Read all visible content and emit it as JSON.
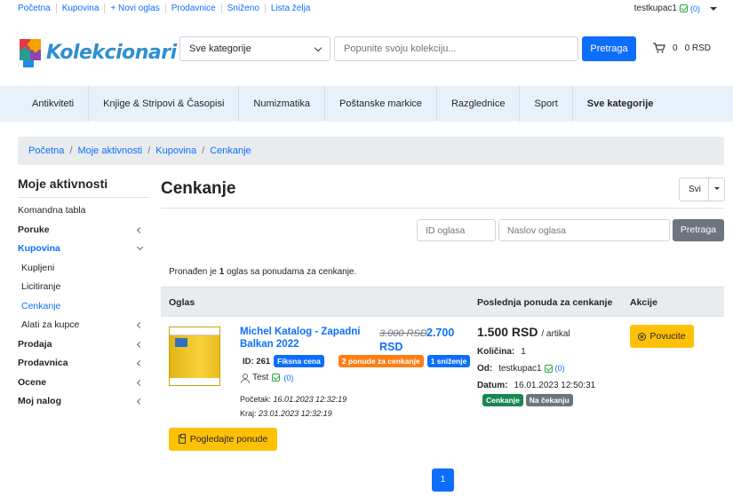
{
  "topbar": {
    "links": [
      "Početna",
      "Kupovina",
      "+ Novi oglas",
      "Prodavnice",
      "Sniženo",
      "Lista želja"
    ],
    "user": "testkupac1",
    "user_count": "(0)"
  },
  "header": {
    "logo_text": "Kolekcionari",
    "category_select": "Sve kategorije",
    "search_placeholder": "Popunite svoju kolekciju...",
    "search_button": "Pretraga",
    "cart_count": "0",
    "cart_total": "0 RSD"
  },
  "nav": [
    "Antikviteti",
    "Knjige & Stripovi & Časopisi",
    "Numizmatika",
    "Poštanske markice",
    "Razglednice",
    "Sport",
    "Sve kategorije"
  ],
  "breadcrumb": [
    "Početna",
    "Moje aktivnosti",
    "Kupovina",
    "Cenkanje"
  ],
  "sidebar": {
    "title": "Moje aktivnosti",
    "items": [
      {
        "label": "Komandna tabla"
      },
      {
        "label": "Poruke"
      },
      {
        "label": "Kupovina"
      },
      {
        "label": "Kupljeni"
      },
      {
        "label": "Licitiranje"
      },
      {
        "label": "Cenkanje"
      },
      {
        "label": "Alati za kupce"
      },
      {
        "label": "Prodaja"
      },
      {
        "label": "Prodavnica"
      },
      {
        "label": "Ocene"
      },
      {
        "label": "Moj nalog"
      }
    ]
  },
  "main": {
    "title": "Cenkanje",
    "filter_value": "Svi",
    "id_placeholder": "ID oglasa",
    "title_placeholder": "Naslov oglasa",
    "search_button": "Pretraga",
    "found_prefix": "Pronađen je",
    "found_count": "1",
    "found_suffix": "oglas sa ponudama za cenkanje.",
    "columns": [
      "Oglas",
      "Poslednja ponuda za cenkanje",
      "Akcije"
    ]
  },
  "listing": {
    "title": "Michel Katalog - Zapadni Balkan 2022",
    "old_price": "3.000 RSD",
    "new_price": "2.700",
    "currency": "RSD",
    "id_label": "ID: 261",
    "badge_fixed": "Fiksna cena",
    "badge_offers": "2 ponude za cenkanje",
    "badge_discount": "1 sniženje",
    "seller": "Test",
    "seller_count": "(0)",
    "start_label": "Početak:",
    "start_date": "16.01.2023 12:32:19",
    "end_label": "Kraj:",
    "end_date": "23.01.2023 12:32:19",
    "view_offers": "Pogledajte ponude"
  },
  "offer": {
    "amount": "1.500 RSD",
    "unit": "/ artikal",
    "qty_label": "Količina:",
    "qty": "1",
    "from_label": "Od:",
    "from": "testkupac1",
    "from_count": "(0)",
    "date_label": "Datum:",
    "date": "16.01.2023 12:50:31",
    "badge_type": "Cenkanje",
    "badge_status": "Na čekanju",
    "withdraw": "Povucite"
  },
  "pagination": {
    "current": "1"
  }
}
